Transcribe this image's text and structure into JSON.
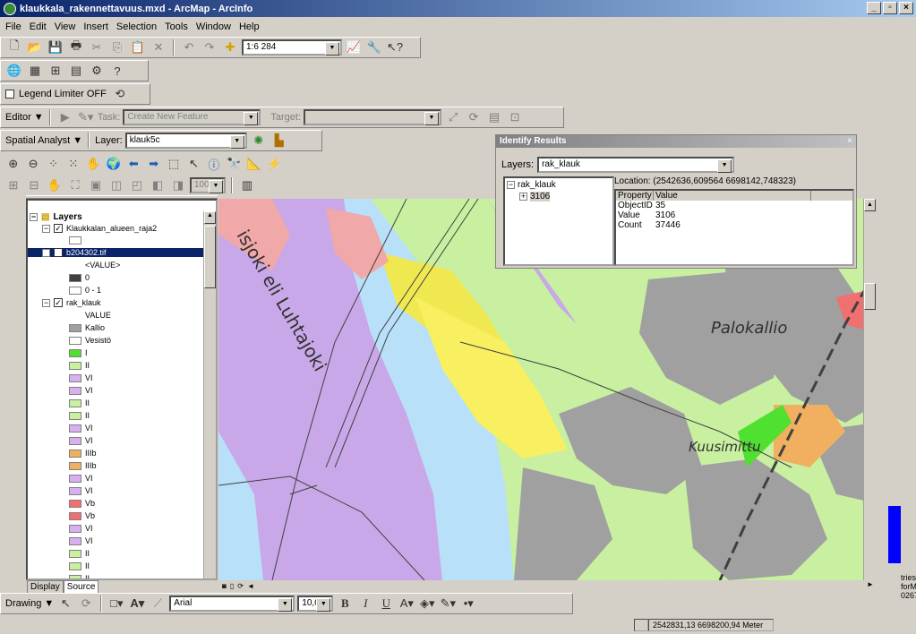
{
  "window": {
    "title": "klaukkala_rakennettavuus.mxd - ArcMap - ArcInfo",
    "min": "_",
    "max": "▫",
    "close": "×"
  },
  "menu": [
    "File",
    "Edit",
    "View",
    "Insert",
    "Selection",
    "Tools",
    "Window",
    "Help"
  ],
  "toolbar": {
    "scale": "1:6 284"
  },
  "legend_limiter": {
    "label": "Legend Limiter OFF"
  },
  "editor": {
    "label": "Editor ▼",
    "task_label": "Task:",
    "task_value": "Create New Feature",
    "target_label": "Target:"
  },
  "spatial": {
    "label": "Spatial Analyst ▼",
    "layer_label": "Layer:",
    "layer_value": "klauk5c"
  },
  "zoom_value": "100%",
  "identify": {
    "title": "Identify Results",
    "layers_label": "Layers:",
    "layers_value": "rak_klauk",
    "tree_root": "rak_klauk",
    "tree_child": "3106",
    "location": "Location: (2542636,609564 6698142,748323)",
    "col_property": "Property",
    "col_value": "Value",
    "rows": [
      {
        "p": "ObjectID",
        "v": "35"
      },
      {
        "p": "Value",
        "v": "3106"
      },
      {
        "p": "Count",
        "v": "37446"
      }
    ]
  },
  "toc": {
    "layers_title": "Layers",
    "items": [
      {
        "label": "Klaukkalan_alueen_raja2"
      },
      {
        "label": "b204302.tif"
      },
      {
        "label": "<VALUE>"
      },
      {
        "label": "0"
      },
      {
        "label": "0 - 1"
      },
      {
        "label": "rak_klauk"
      },
      {
        "label": "VALUE"
      },
      {
        "label": "Kallio"
      },
      {
        "label": "Vesistö"
      },
      {
        "label": "I"
      },
      {
        "label": "II"
      },
      {
        "label": "VI"
      },
      {
        "label": "VI"
      },
      {
        "label": "II"
      },
      {
        "label": "II"
      },
      {
        "label": "VI"
      },
      {
        "label": "VI"
      },
      {
        "label": "IIIb"
      },
      {
        "label": "IIIb"
      },
      {
        "label": "VI"
      },
      {
        "label": "VI"
      },
      {
        "label": "Vb"
      },
      {
        "label": "Vb"
      },
      {
        "label": "VI"
      },
      {
        "label": "VI"
      },
      {
        "label": "II"
      },
      {
        "label": "II"
      },
      {
        "label": "II"
      }
    ],
    "tab_display": "Display",
    "tab_source": "Source"
  },
  "map_labels": {
    "river1": "isjoki eli Luhtajoki",
    "place1": "Palokallio",
    "place2": "Kuusimittu"
  },
  "drawing": {
    "label": "Drawing ▼",
    "font": "Arial",
    "size": "10,00",
    "bold": "B",
    "italic": "I",
    "underline": "U"
  },
  "status": {
    "coords": "2542831,13  6698200,94 Meter"
  },
  "side_text": [
    "tries",
    "forM",
    "0267"
  ],
  "colors": {
    "kallio": "#a0a0a0",
    "I": "#50e030",
    "II": "#c8f0a0",
    "VI": "#d8b0f0",
    "IIIb": "#f0b060",
    "Vb": "#f07070"
  }
}
